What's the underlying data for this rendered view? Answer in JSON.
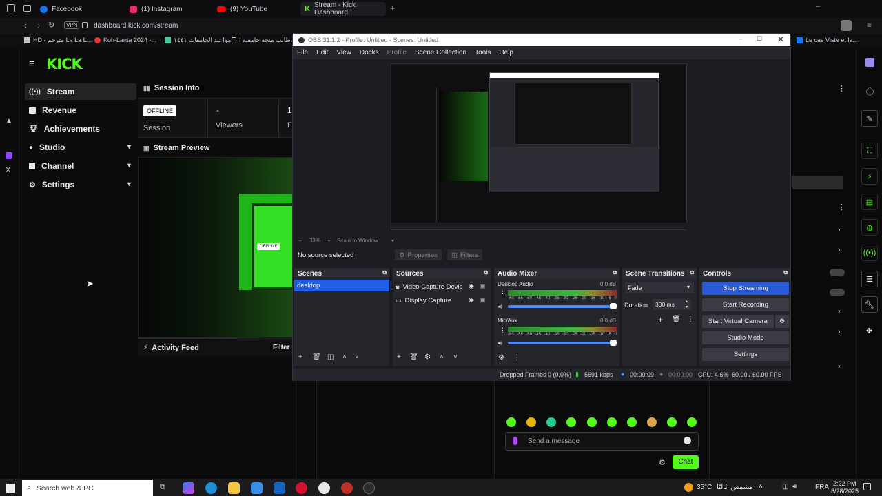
{
  "browser": {
    "tabs": [
      {
        "label": "Facebook",
        "color": "#1877f2"
      },
      {
        "label": "(1) Instagram",
        "color": "#e1306c"
      },
      {
        "label": "(9) YouTube",
        "color": "#ff0000"
      },
      {
        "label": "Stream - Kick Dashboard",
        "color": "#53fc18"
      }
    ],
    "url": "dashboard.kick.com/stream",
    "vpn_label": "VPN",
    "bookmarks": [
      "HD - مترجم La La L...",
      "Koh-Lanta 2024 -...",
      "مواعيد الجامعات ١٤٤١",
      "طالب منحة جامعية ا...",
      "Le cas Viste et la..."
    ]
  },
  "kick": {
    "logo": "KICK",
    "nav": [
      {
        "label": "Stream",
        "icon": "broadcast-icon",
        "active": true
      },
      {
        "label": "Revenue",
        "icon": "money-icon"
      },
      {
        "label": "Achievements",
        "icon": "trophy-icon"
      },
      {
        "label": "Studio",
        "icon": "studio-icon",
        "expandable": true
      },
      {
        "label": "Channel",
        "icon": "channel-icon",
        "expandable": true
      },
      {
        "label": "Settings",
        "icon": "gear-icon",
        "expandable": true
      }
    ],
    "session_info": {
      "title": "Session Info",
      "status_badge": "OFFLINE",
      "session_label": "Session",
      "viewers_value": "-",
      "viewers_label": "Viewers",
      "followers_value": "1",
      "followers_label": "F"
    },
    "stream_preview": {
      "title": "Stream Preview",
      "badge": "OFFLINE"
    },
    "activity_feed": {
      "title": "Activity Feed",
      "filter_label": "Filter"
    },
    "chat": {
      "placeholder": "Send a message",
      "send_label": "Chat"
    }
  },
  "obs": {
    "title": "OBS 31.1.2 - Profile: Untitled - Scenes: Untitled",
    "menu": [
      "File",
      "Edit",
      "View",
      "Docks",
      "Profile",
      "Scene Collection",
      "Tools",
      "Help"
    ],
    "zoom_label": "33%",
    "scale_label": "Scale to Window",
    "no_source": "No source selected",
    "properties_label": "Properties",
    "filters_label": "Filters",
    "scenes": {
      "title": "Scenes",
      "items": [
        "desktop"
      ]
    },
    "sources": {
      "title": "Sources",
      "items": [
        "Video Capture Devic",
        "Display Capture"
      ]
    },
    "mixer": {
      "title": "Audio Mixer",
      "channels": [
        {
          "name": "Desktop Audio",
          "db": "0.0 dB"
        },
        {
          "name": "Mic/Aux",
          "db": "0.0 dB"
        }
      ],
      "scale": [
        "-60",
        "-55",
        "-50",
        "-45",
        "-40",
        "-35",
        "-30",
        "-25",
        "-20",
        "-15",
        "-10",
        "-5",
        "0"
      ]
    },
    "transitions": {
      "title": "Scene Transitions",
      "selected": "Fade",
      "duration_label": "Duration",
      "duration_value": "300 ms"
    },
    "controls": {
      "title": "Controls",
      "buttons": [
        "Stop Streaming",
        "Start Recording",
        "Start Virtual Camera",
        "Studio Mode",
        "Settings"
      ]
    },
    "status": {
      "dropped": "Dropped Frames 0 (0.0%)",
      "bitrate": "5691 kbps",
      "stream_time": "00:00:09",
      "rec_time": "00:00:00",
      "cpu": "CPU: 4.6%",
      "fps": "60.00 / 60.00 FPS"
    }
  },
  "taskbar": {
    "search_placeholder": "Search web & PC",
    "weather_temp": "35°C",
    "weather_text": "مشمس غالبًا",
    "lang": "FRA",
    "time": "2:22 PM",
    "date": "8/28/2025"
  }
}
